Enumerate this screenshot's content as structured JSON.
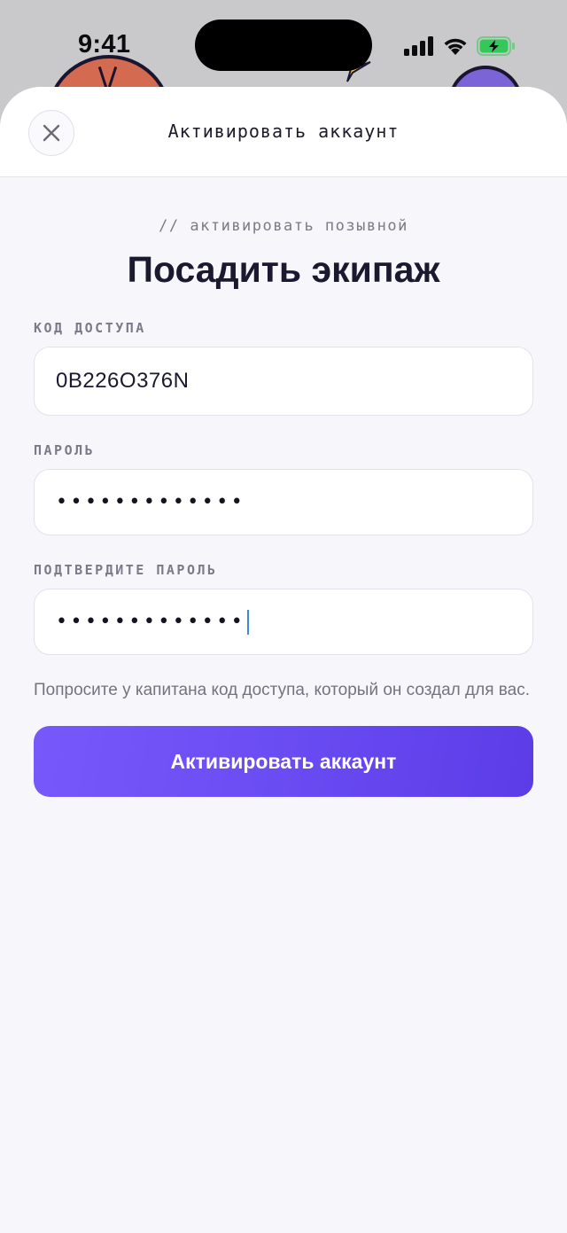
{
  "status_bar": {
    "time": "9:41"
  },
  "sheet": {
    "title": "Активировать аккаунт",
    "close_icon": "close-icon"
  },
  "form": {
    "eyebrow": "// активировать позывной",
    "title": "Посадить экипаж",
    "access_code": {
      "label": "КОД ДОСТУПА",
      "value": "0B226O376N"
    },
    "password": {
      "label": "ПАРОЛЬ",
      "value": "•••••••••••••"
    },
    "confirm_password": {
      "label": "ПОДТВЕРДИТЕ ПАРОЛЬ",
      "value": "•••••••••••••"
    },
    "hint": "Попросите у капитана код доступа, который он создал для вас.",
    "submit_label": "Активировать аккаунт"
  },
  "colors": {
    "accent": "#6a4cf3",
    "battery": "#34c759"
  }
}
